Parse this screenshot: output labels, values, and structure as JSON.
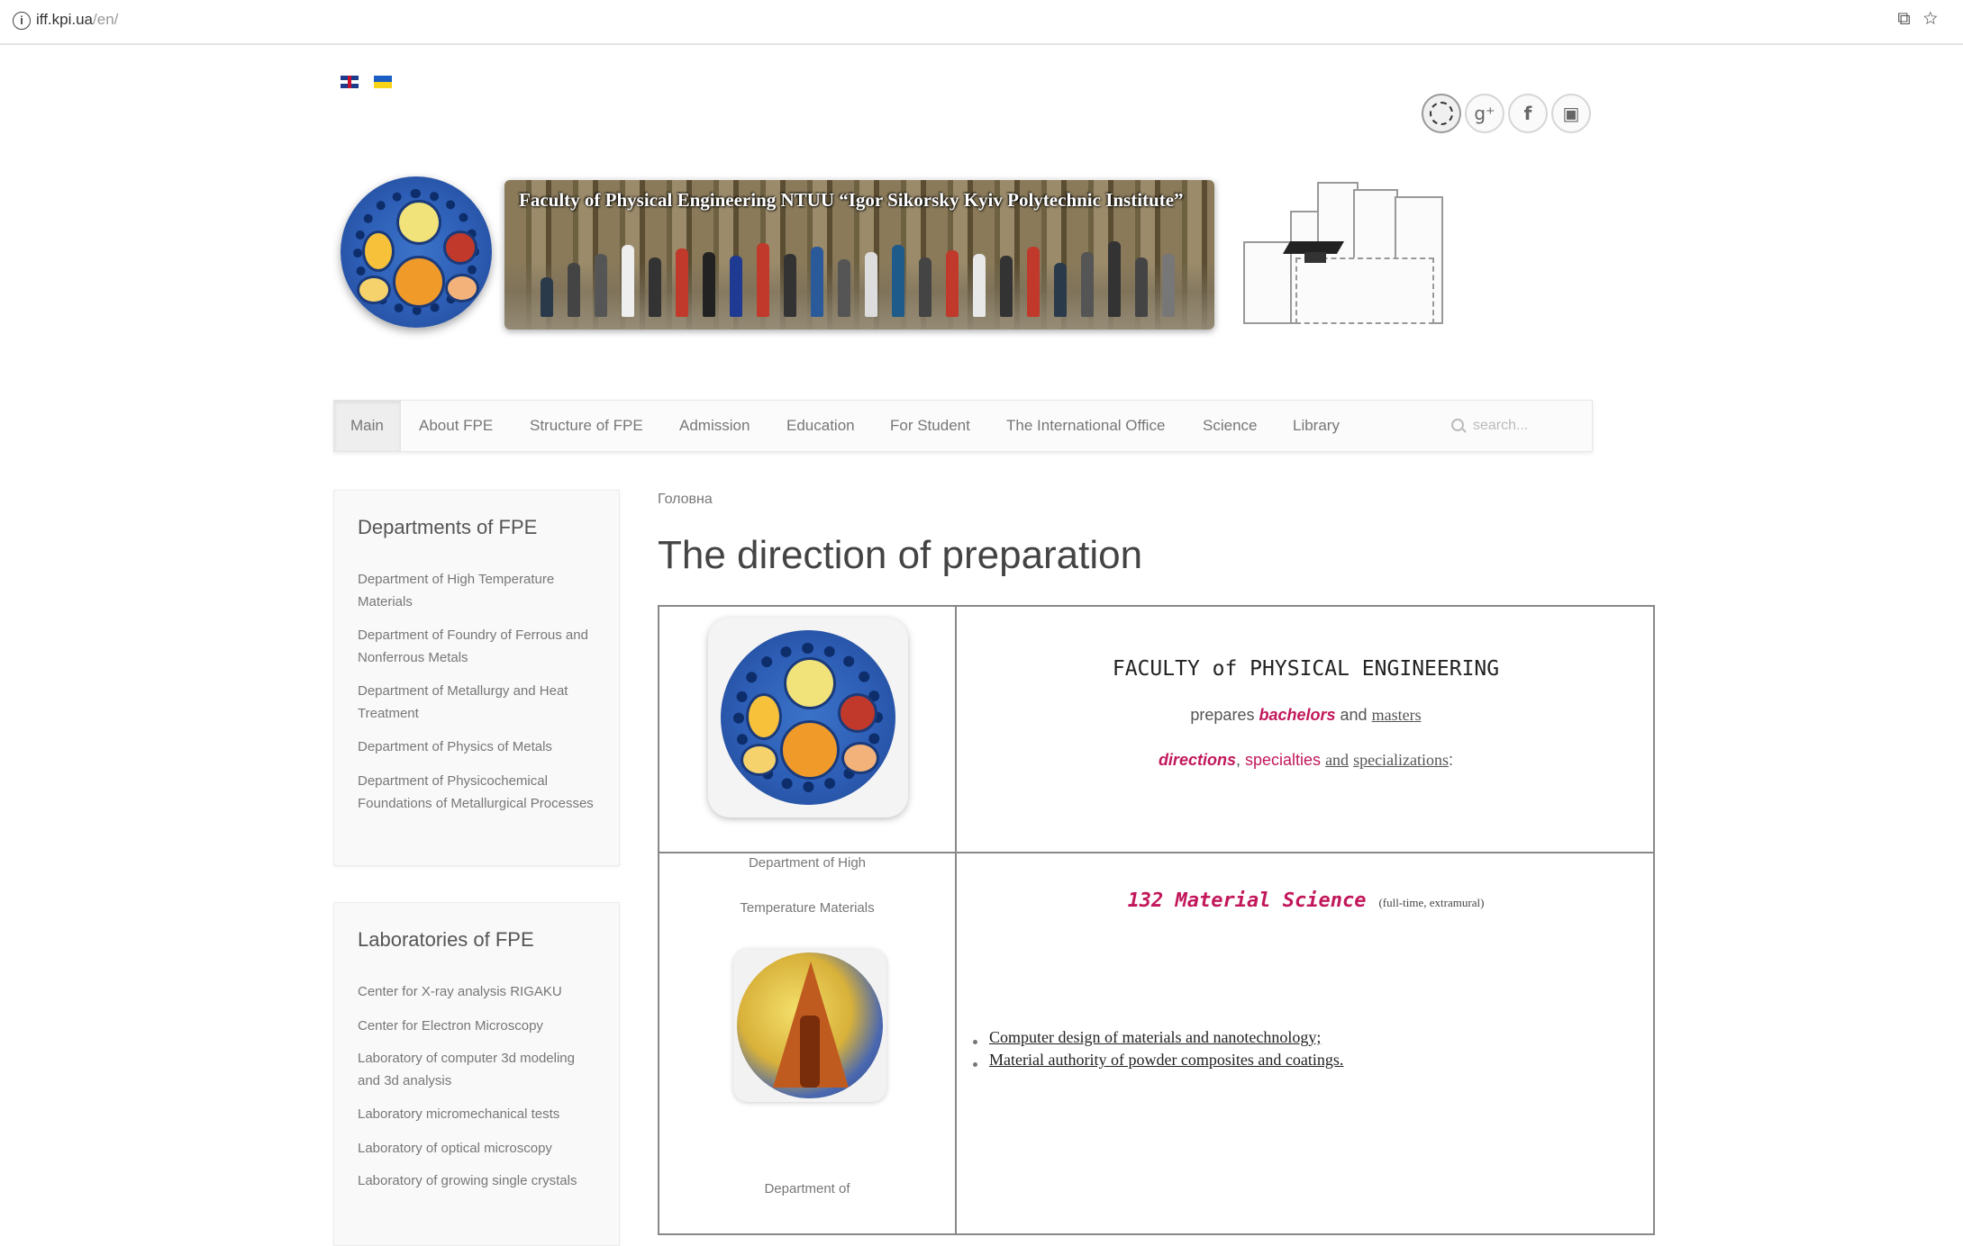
{
  "browser": {
    "url_host": "iff.kpi.ua",
    "url_path": "/en/"
  },
  "languages": [
    "English",
    "Ukrainian"
  ],
  "social": [
    "emblem-icon",
    "google-plus-icon",
    "facebook-icon",
    "youtube-icon"
  ],
  "social_glyphs": {
    "google": "g⁺",
    "facebook": "f",
    "youtube": "▣"
  },
  "header": {
    "banner_title": "Faculty of Physical Engineering NTUU “Igor Sikorsky Kyiv Polytechnic Institute”"
  },
  "nav": {
    "items": [
      "Main",
      "About FPE",
      "Structure of FPE",
      "Admission",
      "Education",
      "For Student",
      "The International Office",
      "Science",
      "Library"
    ],
    "search_placeholder": "search..."
  },
  "sidebar": {
    "departments": {
      "title": "Departments of FPE",
      "items": [
        "Department of High Temperature Materials",
        "Department of Foundry of Ferrous and Nonferrous Metals",
        "Department of Metallurgy and Heat Treatment",
        "Department of Physics of Metals",
        "Department of Physicochemical Foundations of Metallurgical Processes"
      ]
    },
    "laboratories": {
      "title": "Laboratories of FPE",
      "items": [
        "Center for X-ray analysis RIGAKU",
        "Center for Electron Microscopy",
        "Laboratory of computer 3d modeling and 3d analysis",
        "Laboratory micromechanical tests",
        "Laboratory of optical microscopy",
        "Laboratory of growing single crystals"
      ]
    }
  },
  "content": {
    "breadcrumb": "Головна",
    "title": "The direction of preparation",
    "faculty_name": "FACULTY of PHYSICAL ENGINEERING",
    "prepares": "prepares",
    "bachelors": "bachelors",
    "and": "and",
    "masters": "masters",
    "directions": "directions",
    "comma": ",",
    "specialties": "specialties",
    "and2": "and",
    "specializations": "specializations",
    "colon": ":",
    "dept1_line1": "Department of High",
    "dept1_line2": "Temperature Materials",
    "dept2_line1": "Department of",
    "spec_name": "132 Material Science",
    "spec_note": "(full-time, extramural)",
    "spec_items": [
      "Computer design of materials and nanotechnology;",
      "Material authority of powder composites and coatings."
    ]
  },
  "colors": {
    "accent": "#c2185b",
    "text": "#555555",
    "nav_bg": "#fbfbfb"
  }
}
